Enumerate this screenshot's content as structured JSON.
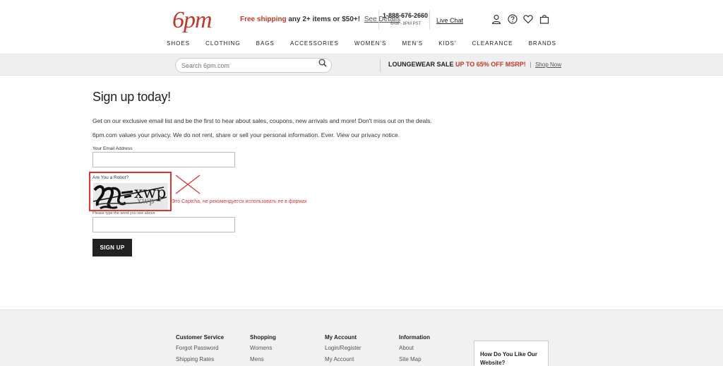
{
  "header": {
    "logo": "6pm",
    "promo_lead": "Free shipping",
    "promo_rest": "any 2+ items or $50+!",
    "promo_link": "See Details",
    "phone": "1-888-676-2660",
    "hours": "6AM - 8PM PST",
    "live_chat": "Live Chat",
    "icons": [
      "user-icon",
      "help-icon",
      "heart-icon",
      "cart-icon"
    ]
  },
  "nav": {
    "items": [
      "SHOES",
      "CLOTHING",
      "BAGS",
      "ACCESSORIES",
      "WOMEN'S",
      "MEN'S",
      "KIDS'",
      "CLEARANCE",
      "BRANDS"
    ]
  },
  "search": {
    "placeholder": "Search 6pm.com"
  },
  "sale": {
    "lead": "LOUNGEWEAR SALE",
    "offer": "UP TO 65% OFF MSRP!",
    "separator": "|",
    "link": "Shop Now"
  },
  "main": {
    "title": "Sign up today!",
    "paragraph1": "Get on our exclusive email list and be the first to hear about sales, coupons, new arrivals and more! Don't miss out on the deals.",
    "paragraph2": "6pm.com values your privacy. We do not rent, share or sell your personal information. Ever. View our privacy notice.",
    "email_label": "Your Email Address",
    "robot_label": "Are You a Robot?",
    "captcha_word": "xwp",
    "captcha_note": "Это Captcha, не рекомендуется использовать ее в формах",
    "type_label": "Please type the word you see above",
    "signup_button": "SIGN UP"
  },
  "footer": {
    "columns": [
      {
        "heading": "Customer Service",
        "items": [
          "Forgot Password",
          "Shipping Rates"
        ]
      },
      {
        "heading": "Shopping",
        "items": [
          "Womens",
          "Mens"
        ]
      },
      {
        "heading": "My Account",
        "items": [
          "Login/Register",
          "My Account"
        ]
      },
      {
        "heading": "Information",
        "items": [
          "About",
          "Site Map"
        ]
      }
    ],
    "feedback": "How Do You Like Our Website?"
  },
  "colors": {
    "brand_red": "#c0392b",
    "annotation_red": "#dd3333",
    "button_black": "#222222"
  }
}
